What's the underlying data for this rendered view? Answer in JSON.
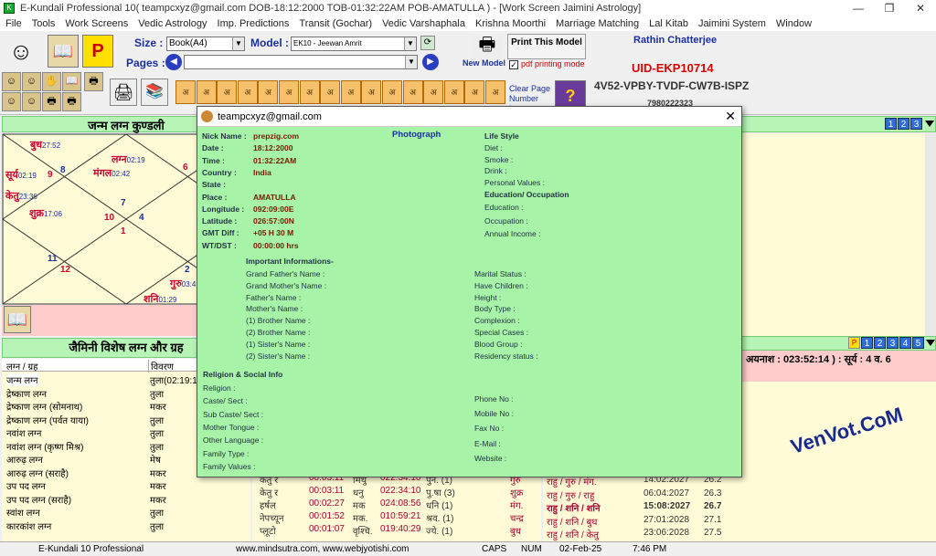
{
  "window": {
    "title": "E-Kundali Professional 10( teampcxyz@gmail.com DOB-18:12:2000 TOB-01:32:22AM POB-AMATULLA ) - [Work Screen Jaimini Astrology]",
    "minimize": "—",
    "restore": "❐",
    "close": "✕"
  },
  "menu": [
    "File",
    "Tools",
    "Work Screens",
    "Vedic Astrology",
    "Imp. Predictions",
    "Transit (Gochar)",
    "Vedic Varshaphala",
    "Krishna Moorthi",
    "Marriage Matching",
    "Lal Kitab",
    "Jaimini System",
    "Window"
  ],
  "toolbar": {
    "size_label": "Size :",
    "size_value": "Book(A4)",
    "model_label": "Model :",
    "model_value": "EK10 - Jeewan Amrit",
    "pages_label": "Pages :",
    "pages_value": "",
    "new_model": "New Model",
    "print_this_model": "Print This Model",
    "pdf_printing": "pdf printing mode",
    "clear_page": "Clear Page",
    "number_log": "Number Log",
    "user_name": "Rathin Chatterjee",
    "uid": "UID-EKP10714",
    "license_key": "4V52-VPBY-TVDF-CW7B-ISPZ",
    "phone": "7980222323",
    "orange_labels": [
      "अ",
      "अ",
      "अ",
      "अ",
      "अ",
      "अ",
      "अ",
      "अ",
      "अ",
      "अ",
      "अ",
      "अ",
      "अ",
      "अ",
      "अ",
      "अ"
    ]
  },
  "left_pane": {
    "chart_title": "जन्म लग्न कुण्डली",
    "planets": [
      {
        "t": "बुध",
        "deg": "27:52"
      },
      {
        "t": "लग्न",
        "deg": "02:19"
      },
      {
        "t": "सूर्य",
        "deg": "02:19"
      },
      {
        "t": "मंगल",
        "deg": "02:42"
      },
      {
        "t": "केतु",
        "deg": "23:36"
      },
      {
        "t": "शुक्र",
        "deg": "17:06"
      },
      {
        "t": "गुरु",
        "deg": "03:4"
      },
      {
        "t": "शनि",
        "deg": "01:29"
      }
    ],
    "house_nums": [
      "9",
      "8",
      "6",
      "7",
      "10",
      "4",
      "1",
      "11",
      "12",
      "2"
    ],
    "special_title": "जैमिनी विशेष लग्न और ग्रह",
    "col_headers": [
      "लग्न / ग्रह",
      "विवरण"
    ],
    "rows": [
      [
        "जन्म लग्न",
        "तुला(02:19:1"
      ],
      [
        "द्रेष्काण लग्न",
        "तुला"
      ],
      [
        "द्रेष्काण लग्न (सोमनाथ)",
        "मकर"
      ],
      [
        "द्रेष्काण लग्न (पर्वत याया)",
        "तुला"
      ],
      [
        "नवांश लग्न",
        "तुला"
      ],
      [
        "नवांश लग्न (कृष्ण मिश्र)",
        "तुला"
      ],
      [
        "आरुढ़ लग्न",
        "मेष"
      ],
      [
        "आरुढ़ लग्न (सराहै)",
        "मकर"
      ],
      [
        "उप पद लग्न",
        "मकर"
      ],
      [
        "उप पद लग्न (सराहै)",
        "मकर"
      ],
      [
        "स्वांश लग्न",
        "तुला"
      ],
      [
        "कारकांश लग्न",
        "तुला"
      ]
    ]
  },
  "right_pane": {
    "tabs_top": [
      "1",
      "2",
      "3"
    ],
    "tabs_mid": [
      "1",
      "2",
      "3",
      "4",
      "5"
    ],
    "ayanamsha": "अयनाश : 023:52:14 ) : सूर्य  :  4 व. 6",
    "dasha_rows": [
      [
        "राहु / गुरु / मंग.",
        "14:02:2027",
        "26.2"
      ],
      [
        "राहु / गुरु / राहु",
        "06:04:2027",
        "26.3"
      ],
      [
        "राहु / शनि / शनि",
        "15:08:2027",
        "26.7"
      ],
      [
        "राहु / शनि / बुध",
        "27:01:2028",
        "27.1"
      ],
      [
        "राहु / शनि / केतु",
        "23:06:2028",
        "27.5"
      ]
    ],
    "planet_rows": [
      [
        "केतु र",
        "00:03:11",
        "मिथु",
        "022:34:10",
        "पुन. (1)",
        "गुरु"
      ],
      [
        "केतु र",
        "00:03:11",
        "धनु",
        "022:34:10",
        "पु.षा (3)",
        "शुक्र"
      ],
      [
        "हर्षल",
        "00:02:27",
        "मक",
        "024:08:56",
        "धनि (1)",
        "मंग."
      ],
      [
        "नेपच्यून",
        "00:01:52",
        "मक.",
        "010:59:21",
        "श्रव. (1)",
        "चन्द्र"
      ],
      [
        "प्लूटो",
        "00:01:07",
        "वृश्चि.",
        "019:40:29",
        "ज्ये. (1)",
        "बुध"
      ]
    ]
  },
  "dialog": {
    "title": "teampcxyz@gmail.com",
    "photograph": "Photograph",
    "personal_labels": [
      "Nick Name :",
      "Date :",
      "Time :",
      "Country :",
      "State :",
      "Place :",
      "Longitude :",
      "Latitude :",
      "GMT Diff :",
      "WT/DST :"
    ],
    "personal_values": [
      "prepzig.com",
      "18:12:2000",
      "01:32:22AM",
      "India",
      "",
      "AMATULLA",
      "092:09:00E",
      "026:57:00N",
      "+05 H 30 M",
      "00:00:00 hrs"
    ],
    "life_style_header": "Life Style",
    "life_style_labels": [
      "Diet :",
      "Smoke :",
      "Drink :",
      "Personal Values :"
    ],
    "education_header": "Education/ Occupation",
    "education_labels": [
      "Education :",
      "Occupation :",
      "Annual Income :"
    ],
    "important_header": "Important Informations-",
    "family_labels": [
      "Grand Father's Name :",
      "Grand Mother's Name :",
      "Father's Name :",
      "Mother's Name :",
      "(1) Brother Name :",
      "(2) Brother Name :",
      "(1) Sister's Name :",
      "(2) Sister's Name :"
    ],
    "physical_labels": [
      "Marital Status :",
      "Have Children :",
      "Height :",
      "Body Type :",
      "Complexion :",
      "Special Cases :",
      "Blood Group :",
      "Residency status :"
    ],
    "religion_header": "Religion & Social Info",
    "religion_labels": [
      "Religion :",
      "Caste/ Sect :",
      "Sub Caste/ Sect :",
      "Mother Tongue :",
      "Other Language :",
      "Family Type :",
      "Family Values :"
    ],
    "contact_labels": [
      "Phone No :",
      "Mobile No :",
      "Fax No :",
      "E-Mail :",
      "Website :"
    ]
  },
  "status": {
    "app": "E-Kundali 10 Professional",
    "sites": "www.mindsutra.com, www.webjyotishi.com",
    "caps": "CAPS",
    "num": "NUM",
    "date": "02-Feb-25",
    "time": "7:46 PM"
  },
  "watermark": "VenVot.CoM"
}
